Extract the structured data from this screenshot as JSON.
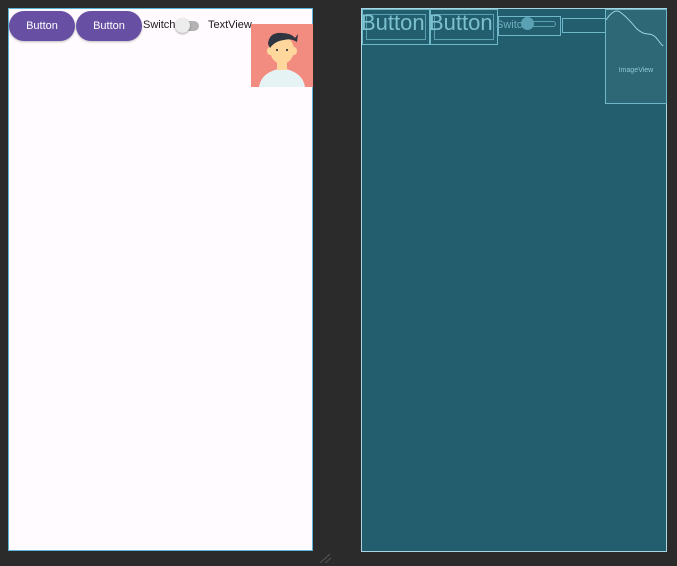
{
  "design": {
    "button_1": "Button",
    "button_2": "Button",
    "switch_label": "Switch",
    "switch_checked": false,
    "textview": "TextView"
  },
  "blueprint": {
    "button_1": "Button",
    "button_2": "Button",
    "switch_label": "Switc",
    "image_label": "ImageView"
  },
  "colors": {
    "button": "#6750a4",
    "canvas_bg": "#2b2b2b",
    "design_surface": "#fffbfe",
    "blueprint_surface": "#225e6e",
    "avatar_bg": "#f28b80"
  }
}
